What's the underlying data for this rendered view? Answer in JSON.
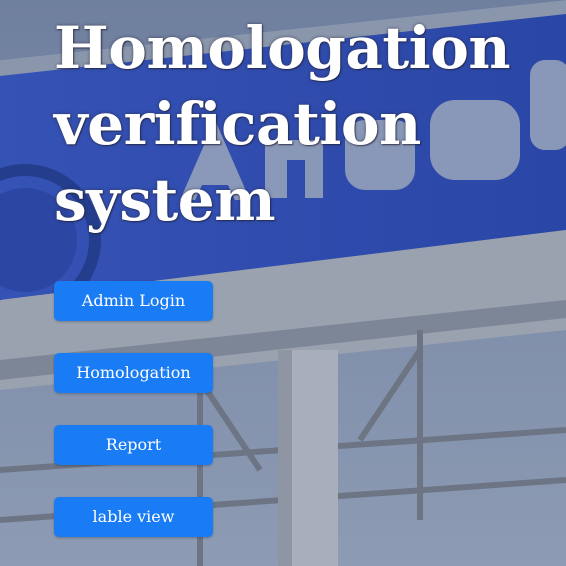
{
  "page": {
    "title": "Homologation verification system"
  },
  "nav": {
    "buttons": [
      {
        "label": "Admin Login"
      },
      {
        "label": "Homologation"
      },
      {
        "label": "Report"
      },
      {
        "label": "lable view"
      }
    ]
  },
  "colors": {
    "button_background": "#1a7cf5",
    "button_text": "#ffffff",
    "title_text": "#ffffff",
    "background_sky": "#7f8fa8",
    "sign_panel": "#2f4fb0"
  }
}
